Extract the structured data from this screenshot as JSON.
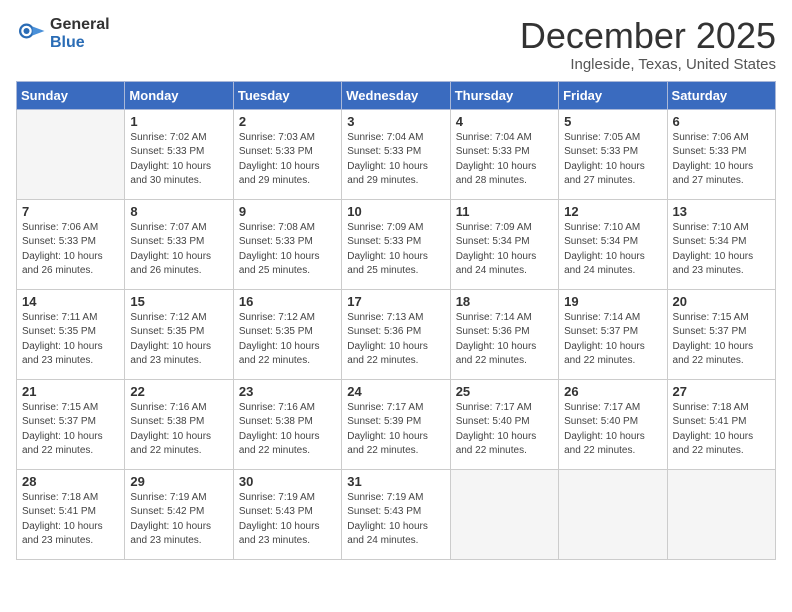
{
  "header": {
    "logo_general": "General",
    "logo_blue": "Blue",
    "month_title": "December 2025",
    "subtitle": "Ingleside, Texas, United States"
  },
  "weekdays": [
    "Sunday",
    "Monday",
    "Tuesday",
    "Wednesday",
    "Thursday",
    "Friday",
    "Saturday"
  ],
  "weeks": [
    [
      {
        "day": "",
        "info": ""
      },
      {
        "day": "1",
        "info": "Sunrise: 7:02 AM\nSunset: 5:33 PM\nDaylight: 10 hours\nand 30 minutes."
      },
      {
        "day": "2",
        "info": "Sunrise: 7:03 AM\nSunset: 5:33 PM\nDaylight: 10 hours\nand 29 minutes."
      },
      {
        "day": "3",
        "info": "Sunrise: 7:04 AM\nSunset: 5:33 PM\nDaylight: 10 hours\nand 29 minutes."
      },
      {
        "day": "4",
        "info": "Sunrise: 7:04 AM\nSunset: 5:33 PM\nDaylight: 10 hours\nand 28 minutes."
      },
      {
        "day": "5",
        "info": "Sunrise: 7:05 AM\nSunset: 5:33 PM\nDaylight: 10 hours\nand 27 minutes."
      },
      {
        "day": "6",
        "info": "Sunrise: 7:06 AM\nSunset: 5:33 PM\nDaylight: 10 hours\nand 27 minutes."
      }
    ],
    [
      {
        "day": "7",
        "info": "Sunrise: 7:06 AM\nSunset: 5:33 PM\nDaylight: 10 hours\nand 26 minutes."
      },
      {
        "day": "8",
        "info": "Sunrise: 7:07 AM\nSunset: 5:33 PM\nDaylight: 10 hours\nand 26 minutes."
      },
      {
        "day": "9",
        "info": "Sunrise: 7:08 AM\nSunset: 5:33 PM\nDaylight: 10 hours\nand 25 minutes."
      },
      {
        "day": "10",
        "info": "Sunrise: 7:09 AM\nSunset: 5:33 PM\nDaylight: 10 hours\nand 25 minutes."
      },
      {
        "day": "11",
        "info": "Sunrise: 7:09 AM\nSunset: 5:34 PM\nDaylight: 10 hours\nand 24 minutes."
      },
      {
        "day": "12",
        "info": "Sunrise: 7:10 AM\nSunset: 5:34 PM\nDaylight: 10 hours\nand 24 minutes."
      },
      {
        "day": "13",
        "info": "Sunrise: 7:10 AM\nSunset: 5:34 PM\nDaylight: 10 hours\nand 23 minutes."
      }
    ],
    [
      {
        "day": "14",
        "info": "Sunrise: 7:11 AM\nSunset: 5:35 PM\nDaylight: 10 hours\nand 23 minutes."
      },
      {
        "day": "15",
        "info": "Sunrise: 7:12 AM\nSunset: 5:35 PM\nDaylight: 10 hours\nand 23 minutes."
      },
      {
        "day": "16",
        "info": "Sunrise: 7:12 AM\nSunset: 5:35 PM\nDaylight: 10 hours\nand 22 minutes."
      },
      {
        "day": "17",
        "info": "Sunrise: 7:13 AM\nSunset: 5:36 PM\nDaylight: 10 hours\nand 22 minutes."
      },
      {
        "day": "18",
        "info": "Sunrise: 7:14 AM\nSunset: 5:36 PM\nDaylight: 10 hours\nand 22 minutes."
      },
      {
        "day": "19",
        "info": "Sunrise: 7:14 AM\nSunset: 5:37 PM\nDaylight: 10 hours\nand 22 minutes."
      },
      {
        "day": "20",
        "info": "Sunrise: 7:15 AM\nSunset: 5:37 PM\nDaylight: 10 hours\nand 22 minutes."
      }
    ],
    [
      {
        "day": "21",
        "info": "Sunrise: 7:15 AM\nSunset: 5:37 PM\nDaylight: 10 hours\nand 22 minutes."
      },
      {
        "day": "22",
        "info": "Sunrise: 7:16 AM\nSunset: 5:38 PM\nDaylight: 10 hours\nand 22 minutes."
      },
      {
        "day": "23",
        "info": "Sunrise: 7:16 AM\nSunset: 5:38 PM\nDaylight: 10 hours\nand 22 minutes."
      },
      {
        "day": "24",
        "info": "Sunrise: 7:17 AM\nSunset: 5:39 PM\nDaylight: 10 hours\nand 22 minutes."
      },
      {
        "day": "25",
        "info": "Sunrise: 7:17 AM\nSunset: 5:40 PM\nDaylight: 10 hours\nand 22 minutes."
      },
      {
        "day": "26",
        "info": "Sunrise: 7:17 AM\nSunset: 5:40 PM\nDaylight: 10 hours\nand 22 minutes."
      },
      {
        "day": "27",
        "info": "Sunrise: 7:18 AM\nSunset: 5:41 PM\nDaylight: 10 hours\nand 22 minutes."
      }
    ],
    [
      {
        "day": "28",
        "info": "Sunrise: 7:18 AM\nSunset: 5:41 PM\nDaylight: 10 hours\nand 23 minutes."
      },
      {
        "day": "29",
        "info": "Sunrise: 7:19 AM\nSunset: 5:42 PM\nDaylight: 10 hours\nand 23 minutes."
      },
      {
        "day": "30",
        "info": "Sunrise: 7:19 AM\nSunset: 5:43 PM\nDaylight: 10 hours\nand 23 minutes."
      },
      {
        "day": "31",
        "info": "Sunrise: 7:19 AM\nSunset: 5:43 PM\nDaylight: 10 hours\nand 24 minutes."
      },
      {
        "day": "",
        "info": ""
      },
      {
        "day": "",
        "info": ""
      },
      {
        "day": "",
        "info": ""
      }
    ]
  ]
}
